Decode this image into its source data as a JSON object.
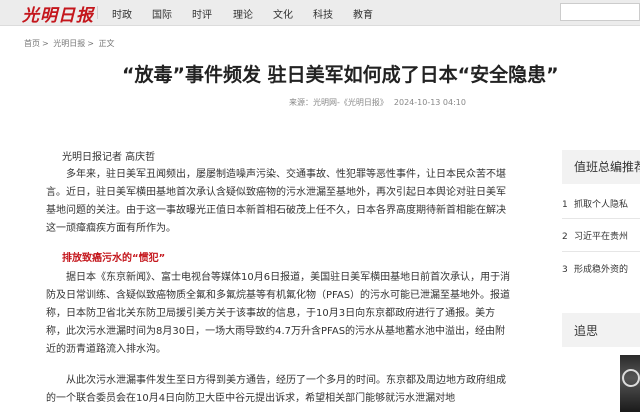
{
  "nav": {
    "logo": "光明日报",
    "items": [
      "时政",
      "国际",
      "时评",
      "理论",
      "文化",
      "科技",
      "教育"
    ]
  },
  "breadcrumb": [
    "首页",
    "光明日报",
    "正文"
  ],
  "breadcrumb_sep": ">",
  "article": {
    "title": "“放毒”事件频发 驻日美军如何成了日本“安全隐患”",
    "source": "来源：光明网-《光明日报》",
    "date": "2024-10-13 04:10",
    "reporter": "光明日报记者 高庆哲",
    "paragraphs": [
      "多年来，驻日美军丑闻频出，屡屡制造噪声污染、交通事故、性犯罪等恶性事件，让日本民众苦不堪言。近日，驻日美军横田基地首次承认含疑似致癌物的污水泄漏至基地外，再次引起日本舆论对驻日美军基地问题的关注。由于这一事故曝光正值日本新首相石破茂上任不久，日本各界高度期待新首相能在解决这一顽瘴痼疾方面有所作为。",
      "据日本《东京新闻》、富士电视台等媒体10月6日报道，美国驻日美军横田基地日前首次承认，用于消防及日常训练、含疑似致癌物质全氟和多氟烷基等有机氟化物（PFAS）的污水可能已泄漏至基地外。报道称，日本防卫省北关东防卫局援引美方关于该事故的信息，于10月3日向东京都政府进行了通报。美方称，此次污水泄漏时间为8月30日，一场大雨导致约4.7万升含PFAS的污水从基地蓄水池中溢出，经由附近的沥青道路流入排水沟。",
      "从此次污水泄漏事件发生至日方得到美方通告，经历了一个多月的时间。东京都及周边地方政府组成的一个联合委员会在10月4日向防卫大臣中谷元提出诉求，希望相关部门能够就污水泄漏对地"
    ],
    "subhead": "排放致癌污水的“惯犯”"
  },
  "sidebar": {
    "section1_title": "值班总编推荐",
    "items": [
      {
        "num": "1",
        "text": "抓取个人隐私"
      },
      {
        "num": "2",
        "text": "习近平在贵州"
      },
      {
        "num": "3",
        "text": "形成稳外资的"
      }
    ],
    "section2_title": "追思"
  }
}
